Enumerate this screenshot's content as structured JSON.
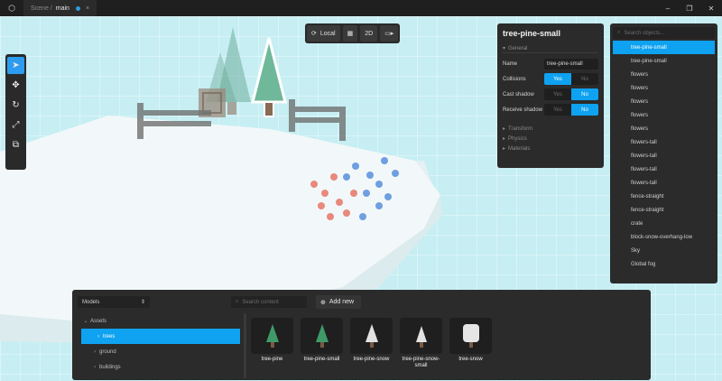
{
  "tab": {
    "path": "Scene / ",
    "name": "main",
    "close": "×"
  },
  "window": {
    "minimize": "–",
    "maximize": "❐",
    "close": "✕"
  },
  "toolbar": {
    "space_label": "Local",
    "view_mode_label": "2D"
  },
  "inspector": {
    "title": "tree-pine-small",
    "section": "General",
    "name_label": "Name",
    "name_value": "tree-pine-small",
    "collisions_label": "Collisions",
    "cast_shadow_label": "Cast shadow",
    "receive_shadow_label": "Receive shadow",
    "yes": "Yes",
    "no": "No",
    "collisions": "Yes",
    "cast_shadow": "No",
    "receive_shadow": "No",
    "collapsed_sections": [
      "Transform",
      "Physics",
      "Materials"
    ]
  },
  "outliner": {
    "search_placeholder": "Search objects...",
    "items": [
      "tree-pine-small",
      "tree-pine-small",
      "flowers",
      "flowers",
      "flowers",
      "flowers",
      "flowers",
      "flowers-tall",
      "flowers-tall",
      "flowers-tall",
      "flowers-tall",
      "fence-straight",
      "fence-straight",
      "crate",
      "block-snow-overhang-low",
      "Sky",
      "Global fog"
    ],
    "selected_index": 0
  },
  "browser": {
    "category": "Models",
    "search_placeholder": "Search content",
    "add_label": "Add new",
    "tree": {
      "root": "Assets",
      "children": [
        "trees",
        "ground",
        "buildings"
      ],
      "selected_index": 0
    },
    "assets": [
      {
        "name": "tree-pine",
        "kind": "green"
      },
      {
        "name": "tree-pine-small",
        "kind": "green"
      },
      {
        "name": "tree-pine-snow",
        "kind": "snow"
      },
      {
        "name": "tree-pine-snow-small",
        "kind": "snow"
      },
      {
        "name": "tree-snow",
        "kind": "round-snow"
      }
    ]
  },
  "colors": {
    "accent": "#0ea2f0",
    "panel": "#2b2b2b",
    "viewport": "#c6eef3"
  }
}
